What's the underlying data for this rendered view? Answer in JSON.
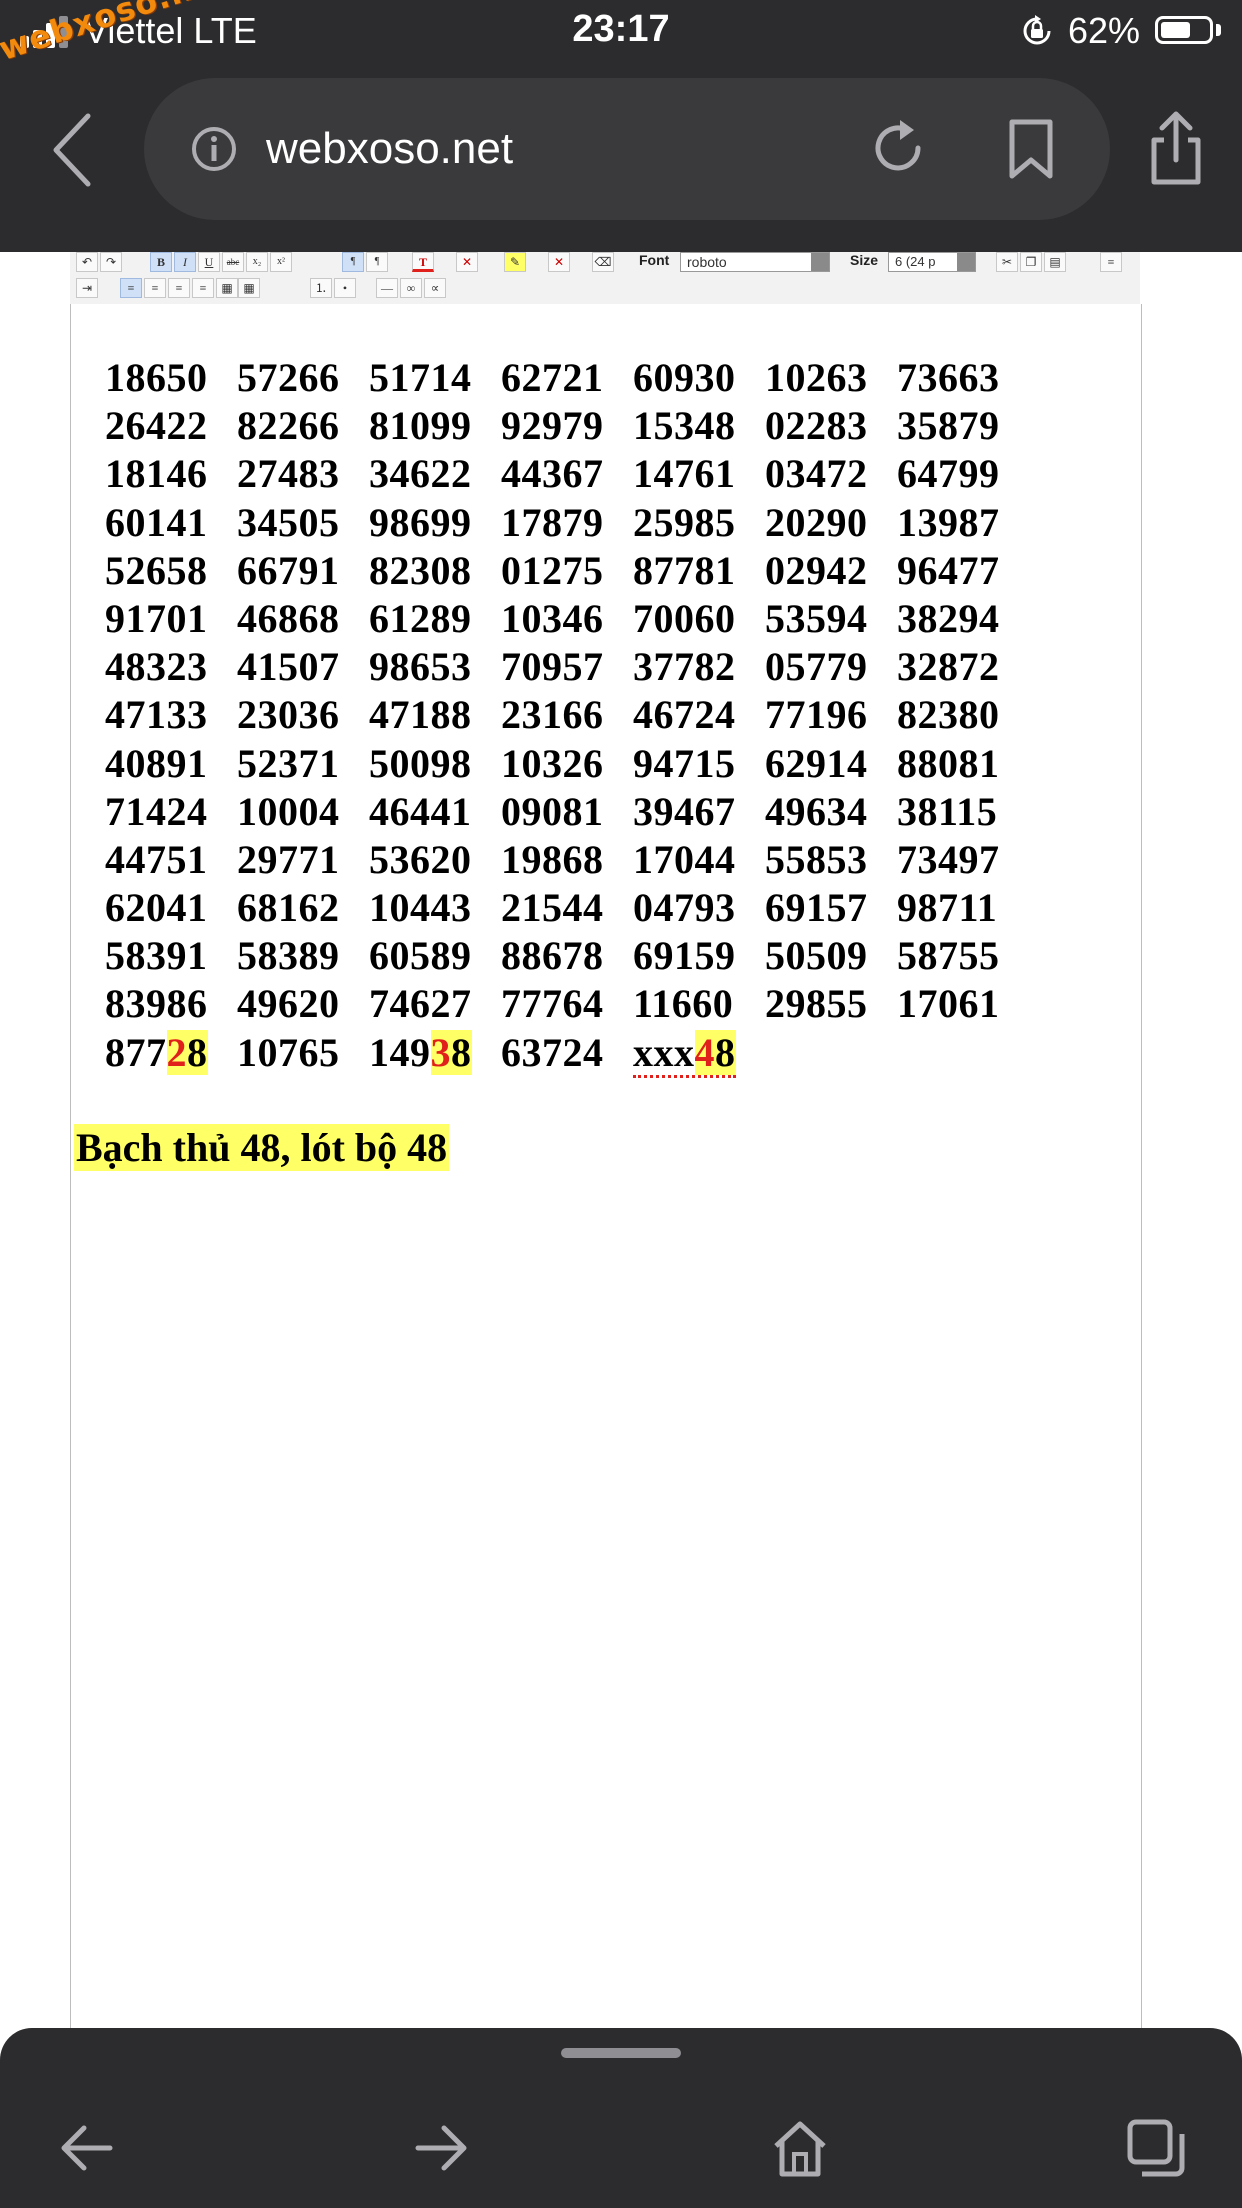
{
  "status_bar": {
    "carrier": "Viettel",
    "network": "LTE",
    "time": "23:17",
    "battery_percent": "62%",
    "battery_level": 0.62,
    "watermark": "webxoso.net"
  },
  "browser": {
    "url": "webxoso.net",
    "icons": [
      "chevron-left-icon",
      "info-icon",
      "reload-icon",
      "bookmark-icon",
      "share-icon"
    ]
  },
  "toolbar": {
    "font_label": "Font",
    "font_value": "roboto",
    "size_label": "Size",
    "size_value": "6 (24 p"
  },
  "numbers": [
    [
      "18650",
      "57266",
      "51714",
      "62721",
      "60930",
      "10263",
      "73663"
    ],
    [
      "26422",
      "82266",
      "81099",
      "92979",
      "15348",
      "02283",
      "35879"
    ],
    [
      "18146",
      "27483",
      "34622",
      "44367",
      "14761",
      "03472",
      "64799"
    ],
    [
      "60141",
      "34505",
      "98699",
      "17879",
      "25985",
      "20290",
      "13987"
    ],
    [
      "52658",
      "66791",
      "82308",
      "01275",
      "87781",
      "02942",
      "96477"
    ],
    [
      "91701",
      "46868",
      "61289",
      "10346",
      "70060",
      "53594",
      "38294"
    ],
    [
      "48323",
      "41507",
      "98653",
      "70957",
      "37782",
      "05779",
      "32872"
    ],
    [
      "47133",
      "23036",
      "47188",
      "23166",
      "46724",
      "77196",
      "82380"
    ],
    [
      "40891",
      "52371",
      "50098",
      "10326",
      "94715",
      "62914",
      "88081"
    ],
    [
      "71424",
      "10004",
      "46441",
      "09081",
      "39467",
      "49634",
      "38115"
    ],
    [
      "44751",
      "29771",
      "53620",
      "19868",
      "17044",
      "55853",
      "73497"
    ],
    [
      "62041",
      "68162",
      "10443",
      "21544",
      "04793",
      "69157",
      "98711"
    ],
    [
      "58391",
      "58389",
      "60589",
      "88678",
      "69159",
      "50509",
      "58755"
    ],
    [
      "83986",
      "49620",
      "74627",
      "77764",
      "11660",
      "29855",
      "17061"
    ]
  ],
  "last_row": [
    {
      "prefix": "877",
      "hl_red": "2",
      "hl_black": "8"
    },
    {
      "text": "10765"
    },
    {
      "prefix": "149",
      "hl_red": "3",
      "hl_black": "8"
    },
    {
      "text": "63724"
    },
    {
      "prefix": "xxx",
      "hl_red": "4",
      "hl_black": "8",
      "spell_error": true
    }
  ],
  "conclusion": "Bạch thủ 48, lót bộ 48",
  "colors": {
    "chrome_bg": "#2c2c2e",
    "highlight": "#ffff66",
    "red_digit": "#e0201a",
    "watermark": "#f28a0e"
  },
  "bottom_nav": {
    "icons": [
      "back-arrow-icon",
      "forward-arrow-icon",
      "home-icon",
      "tabs-icon"
    ]
  }
}
